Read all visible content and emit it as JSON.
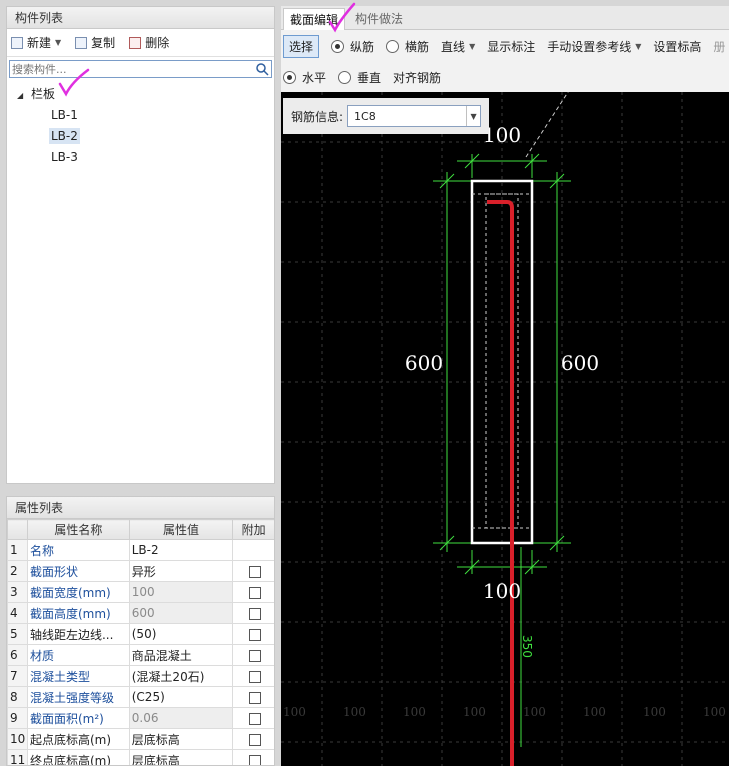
{
  "component_panel": {
    "title": "构件列表",
    "toolbar": {
      "new_label": "新建",
      "copy_label": "复制",
      "delete_label": "删除"
    },
    "search_placeholder": "搜索构件...",
    "tree": {
      "root": "栏板",
      "children": [
        "LB-1",
        "LB-2",
        "LB-3"
      ],
      "selected": "LB-2"
    }
  },
  "property_panel": {
    "title": "属性列表",
    "columns": [
      "属性名称",
      "属性值",
      "附加"
    ],
    "rows": [
      {
        "idx": "1",
        "name": "名称",
        "value": "LB-2",
        "blue": true,
        "grey": false,
        "checkbox": false
      },
      {
        "idx": "2",
        "name": "截面形状",
        "value": "异形",
        "blue": true,
        "grey": false,
        "checkbox": true
      },
      {
        "idx": "3",
        "name": "截面宽度(mm)",
        "value": "100",
        "blue": true,
        "grey": true,
        "checkbox": true
      },
      {
        "idx": "4",
        "name": "截面高度(mm)",
        "value": "600",
        "blue": true,
        "grey": true,
        "checkbox": true
      },
      {
        "idx": "5",
        "name": "轴线距左边线...",
        "value": "(50)",
        "blue": false,
        "grey": false,
        "checkbox": true
      },
      {
        "idx": "6",
        "name": "材质",
        "value": "商品混凝土",
        "blue": true,
        "grey": false,
        "checkbox": true
      },
      {
        "idx": "7",
        "name": "混凝土类型",
        "value": "(混凝土20石)",
        "blue": true,
        "grey": false,
        "checkbox": true
      },
      {
        "idx": "8",
        "name": "混凝土强度等级",
        "value": "(C25)",
        "blue": true,
        "grey": false,
        "checkbox": true
      },
      {
        "idx": "9",
        "name": "截面面积(m²)",
        "value": "0.06",
        "blue": true,
        "grey": true,
        "checkbox": true
      },
      {
        "idx": "10",
        "name": "起点底标高(m)",
        "value": "层底标高",
        "blue": false,
        "grey": false,
        "checkbox": true
      },
      {
        "idx": "11",
        "name": "终点底标高(m)",
        "value": "层底标高",
        "blue": false,
        "grey": false,
        "checkbox": true
      }
    ]
  },
  "editor": {
    "tabs": [
      "截面编辑",
      "构件做法"
    ],
    "toolbar1": {
      "select": "选择",
      "longitudinal": "纵筋",
      "transverse": "横筋",
      "line": "直线",
      "show_dim": "显示标注",
      "manual_ref": "手动设置参考线",
      "set_elev": "设置标高",
      "cut": "册"
    },
    "toolbar2": {
      "horizontal": "水平",
      "vertical": "垂直",
      "align": "对齐钢筋"
    },
    "rebar_info": {
      "label": "钢筋信息:",
      "value": "1C8"
    }
  },
  "drawing": {
    "dim_top": "100",
    "dim_bottom": "100",
    "dim_left": "600",
    "dim_right": "600",
    "dim_rebar": "350",
    "grid_labels": [
      "100",
      "100",
      "100",
      "100",
      "100",
      "100",
      "100",
      "100"
    ],
    "colors": {
      "section": "#ffffff",
      "dimension": "#3fe03f",
      "rebar": "#d9202a",
      "grid": "#4a4a4a",
      "check": "#e030e0"
    }
  }
}
